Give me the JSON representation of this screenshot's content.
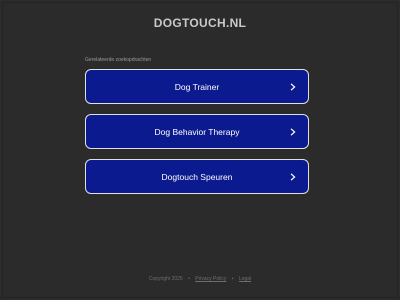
{
  "site": {
    "title": "DOGTOUCH.NL"
  },
  "related": {
    "label": "Gerelateerde zoekopdrachten"
  },
  "links": [
    {
      "label": "Dog Trainer",
      "icon": "chevron-right-icon"
    },
    {
      "label": "Dog Behavior Therapy",
      "icon": "chevron-right-icon"
    },
    {
      "label": "Dogtouch Speuren",
      "icon": "chevron-right-icon"
    }
  ],
  "footer": {
    "copyright": "Copyright 2025",
    "separator": "•",
    "privacy": "Privacy Policy",
    "legal": "Legal"
  },
  "colors": {
    "background": "#2b2b2b",
    "link_box": "#0b1a8f",
    "link_border": "#e0e0e0"
  }
}
